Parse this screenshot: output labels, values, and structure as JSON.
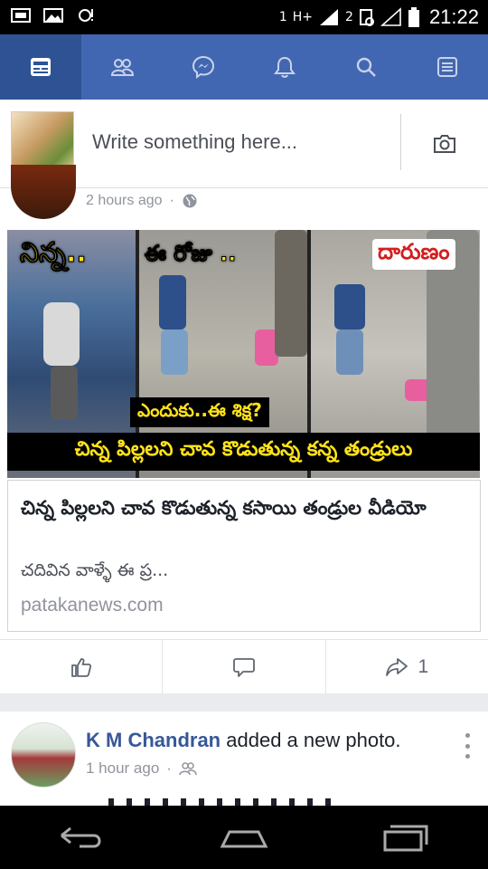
{
  "status_bar": {
    "network_label": "H+",
    "sim1": "1",
    "sim2": "2",
    "time": "21:22"
  },
  "nav": {
    "tabs": [
      {
        "icon": "news-feed-icon",
        "active": true
      },
      {
        "icon": "friends-icon",
        "active": false
      },
      {
        "icon": "messenger-icon",
        "active": false
      },
      {
        "icon": "notifications-icon",
        "active": false
      },
      {
        "icon": "search-icon",
        "active": false
      },
      {
        "icon": "menu-icon",
        "active": false
      }
    ],
    "bg_color": "#4267b2",
    "active_color": "#2f5294"
  },
  "composer": {
    "placeholder": "Write something here...",
    "icon": "camera-icon"
  },
  "post1": {
    "time": "2 hours ago",
    "privacy_icon": "globe-icon",
    "image_captions": {
      "cap1": "నిన్న..",
      "cap2": "ఈ రోజు ..",
      "cap3": "దారుణం",
      "cap4": "ఎందుకు..ఈ శిక్ష?",
      "cap5": "చిన్న పిల్లలని చావ కొడుతున్న కన్న తండ్రులు"
    },
    "link": {
      "title": "చిన్న పిల్లలని చావ కొడుతున్న కసాయి తండ్రుల వీడియో",
      "description": "చదివిన వాళ్ళే ఈ ప్ర...",
      "domain": "patakanews.com"
    },
    "actions": {
      "like_icon": "like-icon",
      "comment_icon": "comment-icon",
      "share_icon": "share-icon",
      "share_count": "1"
    }
  },
  "post2": {
    "author": "K M Chandran",
    "action": "added a new photo.",
    "time": "1 hour ago",
    "privacy_icon": "friends-icon"
  },
  "android_nav": {
    "back_icon": "back-icon",
    "home_icon": "home-icon",
    "recents_icon": "recents-icon"
  }
}
